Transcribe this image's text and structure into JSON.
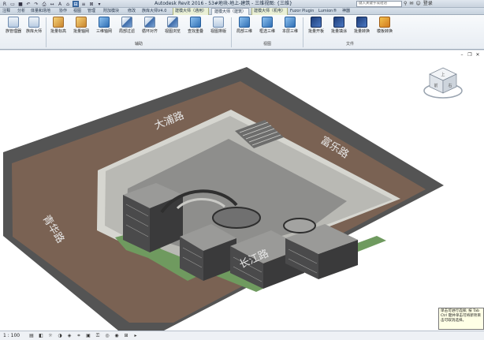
{
  "app": {
    "title": "Autodesk Revit 2016 -    53#地块-地上-建筑 - 三维视图: {三维}",
    "search_placeholder": "键入关键字或短语",
    "login_label": "登录"
  },
  "quick_access": {
    "icons": [
      "r-logo-icon",
      "open-icon",
      "save-icon",
      "undo-icon",
      "redo-icon",
      "print-icon",
      "measure-icon",
      "text-icon",
      "3d-view-icon",
      "section-icon",
      "thin-lines-icon",
      "close-hidden-icon",
      "switch-windows-icon"
    ]
  },
  "tabs": [
    {
      "label": "注释"
    },
    {
      "label": "分析"
    },
    {
      "label": "体量和场地"
    },
    {
      "label": "协作"
    },
    {
      "label": "视图"
    },
    {
      "label": "管理"
    },
    {
      "label": "附加模块"
    },
    {
      "label": "修改"
    },
    {
      "label": "族库大师V4.0"
    },
    {
      "label": "建模大师（通用）"
    },
    {
      "label": "建模大师（建筑）"
    },
    {
      "label": "建模大师（机电）"
    },
    {
      "label": "Fuzor Plugin"
    },
    {
      "label": "Lumion®"
    },
    {
      "label": "神器"
    }
  ],
  "ribbon": {
    "buttons": [
      {
        "label": "族管理器",
        "icon": "family-manager-icon"
      },
      {
        "label": "族库大师",
        "icon": "family-library-icon"
      },
      {
        "label": "批量标高",
        "icon": "batch-level-icon"
      },
      {
        "label": "批量轴网",
        "icon": "batch-grid-icon"
      },
      {
        "label": "三维轴网",
        "icon": "3d-grid-icon"
      },
      {
        "label": "局部过滤",
        "icon": "local-filter-icon"
      },
      {
        "label": "循环对齐",
        "icon": "cycle-align-icon"
      },
      {
        "label": "视图浏览",
        "icon": "view-browse-icon"
      },
      {
        "label": "查找重叠",
        "icon": "find-overlap-icon"
      },
      {
        "label": "视图排版",
        "icon": "view-layout-icon"
      },
      {
        "label": "局部三维",
        "icon": "local-3d-icon"
      },
      {
        "label": "框选三维",
        "icon": "box-3d-icon"
      },
      {
        "label": "本层三维",
        "icon": "floor-3d-icon"
      },
      {
        "label": "批量开板",
        "icon": "batch-slab-icon"
      },
      {
        "label": "批量填涂",
        "icon": "batch-fill-icon"
      },
      {
        "label": "批量转换",
        "icon": "batch-convert-icon"
      },
      {
        "label": "模板转换",
        "icon": "template-convert-icon"
      }
    ],
    "panels": [
      {
        "label": "辅助"
      },
      {
        "label": "视图"
      },
      {
        "label": "文件"
      }
    ]
  },
  "scene": {
    "road_labels": [
      {
        "label": "大浦路"
      },
      {
        "label": "富乐路"
      },
      {
        "label": "青华路"
      },
      {
        "label": "长江路"
      }
    ],
    "colors": {
      "road": "#545454",
      "site_soil": "#7a6253",
      "curb": "#d6d6d0",
      "grass": "#6f9a5f",
      "pavement": "#b9b9b4",
      "building_roof": "#8e8e8c",
      "building_wall": "#3f3f40"
    }
  },
  "viewcube": {
    "faces": [
      "上",
      "前",
      "右"
    ],
    "icon": "viewcube-icon"
  },
  "tooltip": {
    "lines": [
      "单击可进行选择; 按 Tab",
      "Ctrl 键并单击可将新项目",
      "击可取消选择。"
    ]
  },
  "viewbar": {
    "scale": "1 : 100",
    "icons": [
      "detail-level-icon",
      "visual-style-icon",
      "sun-path-icon",
      "shadows-icon",
      "render-icon",
      "crop-icon",
      "show-crop-icon",
      "lock-view-icon",
      "temp-hide-icon",
      "reveal-hidden-icon",
      "analysis-icon",
      "highlight-icon"
    ]
  },
  "viewport_controls": [
    "minimize-icon",
    "restore-icon",
    "close-icon"
  ]
}
